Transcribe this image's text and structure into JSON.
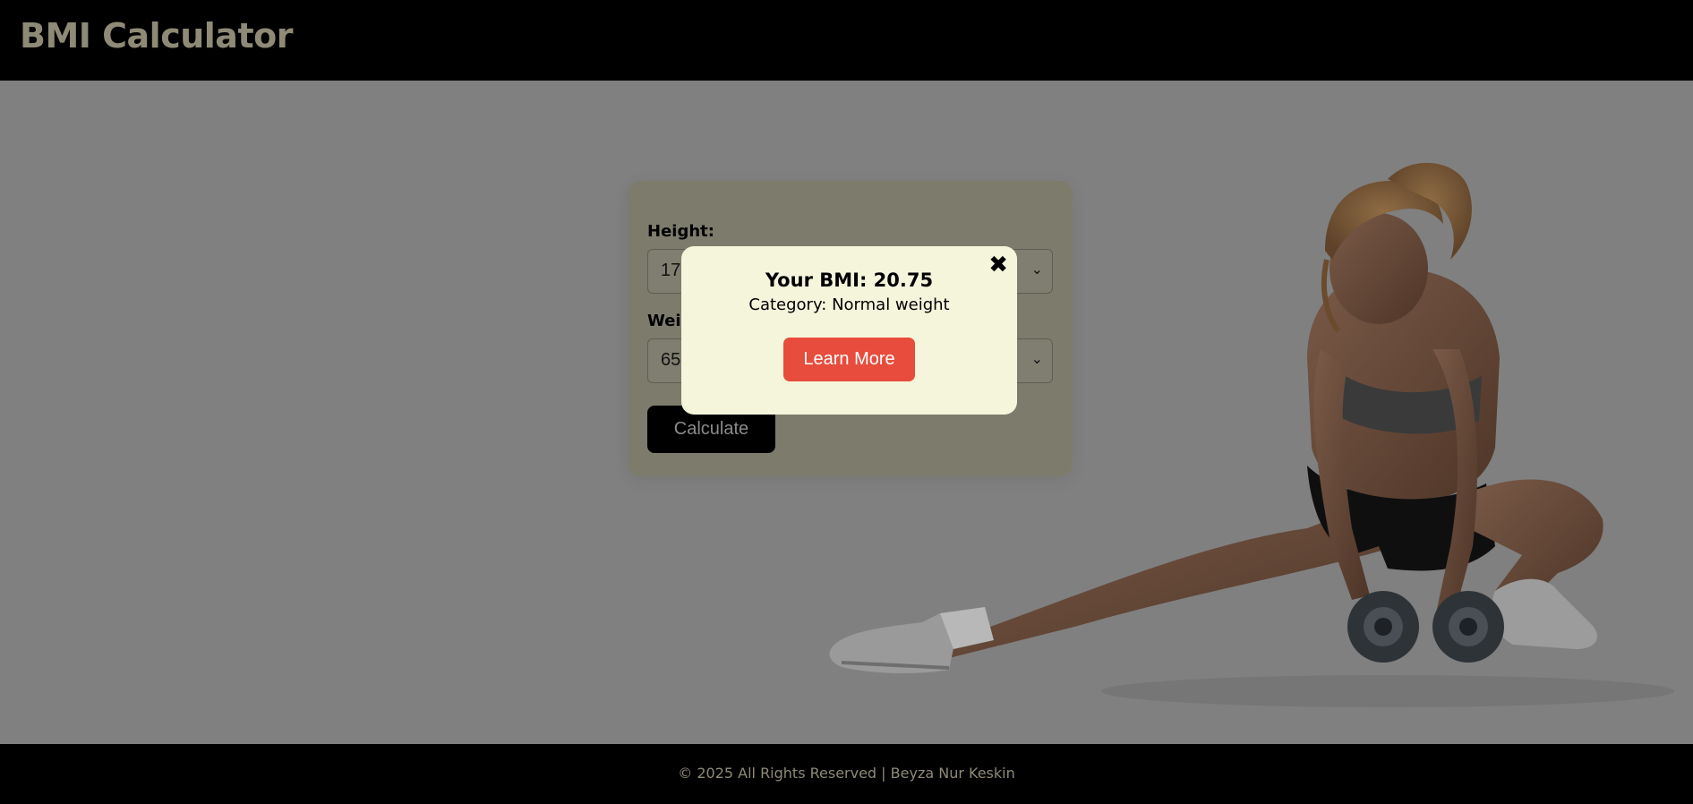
{
  "header": {
    "title": "BMI Calculator"
  },
  "form": {
    "height_label": "Height:",
    "height_value": "17",
    "weight_label": "Weig",
    "weight_value": "65",
    "calculate_label": "Calculate"
  },
  "modal": {
    "close_glyph": "✖",
    "bmi_text": "Your BMI: 20.75",
    "category_text": "Category: Normal weight",
    "learn_more_label": "Learn More"
  },
  "footer": {
    "text": "© 2025 All Rights Reserved | Beyza Nur Keskin"
  },
  "colors": {
    "header_bg": "#000000",
    "title_color": "#8e8a76",
    "overlay": "#808080",
    "modal_bg": "#f5f5dc",
    "learn_more_bg": "#e74c3c"
  }
}
